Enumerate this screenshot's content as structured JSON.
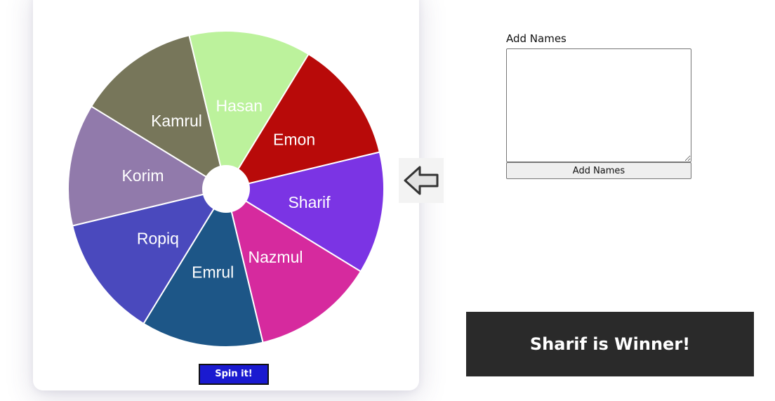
{
  "wheel": {
    "segments": [
      {
        "name": "Sharif",
        "color": "#7b34e4"
      },
      {
        "name": "Nazmul",
        "color": "#d62a9e"
      },
      {
        "name": "Emrul",
        "color": "#1d5687"
      },
      {
        "name": "Ropiq",
        "color": "#4a49bd"
      },
      {
        "name": "Korim",
        "color": "#917aab"
      },
      {
        "name": "Kamrul",
        "color": "#77765a"
      },
      {
        "name": "Hasan",
        "color": "#bcf29c"
      },
      {
        "name": "Emon",
        "color": "#b80a09"
      }
    ],
    "selected": "Sharif",
    "pointer_icon": "left-arrow-icon"
  },
  "spin": {
    "label": "Spin it!",
    "color": "#1a1ad0"
  },
  "add_names": {
    "label": "Add Names",
    "textarea_value": "",
    "button_label": "Add Names"
  },
  "result": {
    "text": "Sharif is Winner!",
    "background": "#2a2a2a"
  }
}
